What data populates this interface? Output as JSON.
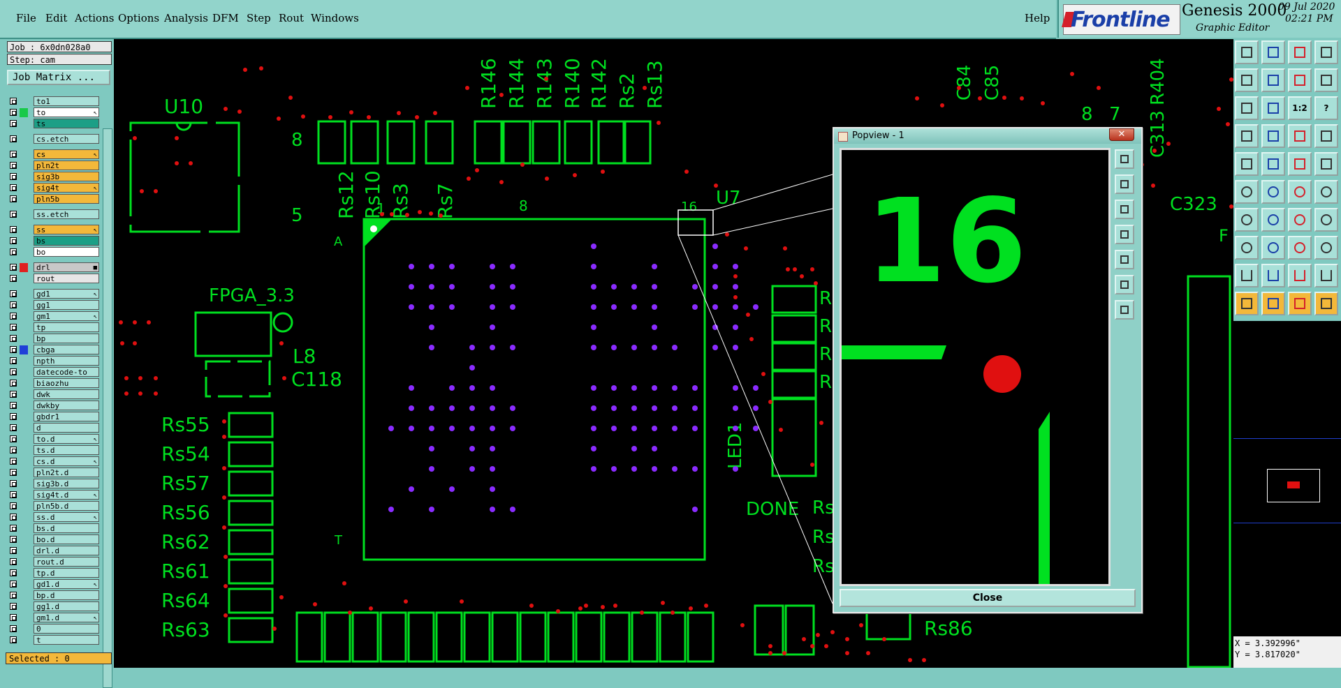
{
  "menu": [
    "File",
    "Edit",
    "Actions",
    "Options",
    "Analysis",
    "DFM",
    "Step",
    "Rout",
    "Windows"
  ],
  "help": "Help",
  "brand": {
    "logo": "Frontline",
    "product": "Genesis 2000",
    "subtitle": "Graphic Editor",
    "date": "09 Jul 2020",
    "time": "02:21 PM"
  },
  "job": {
    "job_label": "Job : 6x0dn028a0",
    "step_label": "Step: cam",
    "matrix_button": "Job Matrix ..."
  },
  "layers": [
    {
      "name": "to1",
      "color": "#a9e0d8"
    },
    {
      "name": "to",
      "color": "#ffffff",
      "swatch": "#18c94a",
      "flag": "↖"
    },
    {
      "name": "ts",
      "color": "#1c9f86"
    },
    {
      "name": "cs.etch",
      "color": "#a9e0d8"
    },
    {
      "name": "cs",
      "color": "#f3b83a",
      "flag": "↖"
    },
    {
      "name": "pln2t",
      "color": "#f3b83a"
    },
    {
      "name": "sig3b",
      "color": "#f3b83a"
    },
    {
      "name": "sig4t",
      "color": "#f3b83a",
      "flag": "↖"
    },
    {
      "name": "pln5b",
      "color": "#f3b83a"
    },
    {
      "name": "ss.etch",
      "color": "#a9e0d8"
    },
    {
      "name": "ss",
      "color": "#f3b83a",
      "flag": "↖"
    },
    {
      "name": "bs",
      "color": "#1c9f86"
    },
    {
      "name": "bo",
      "color": "#ffffff"
    },
    {
      "name": "drl",
      "color": "#c8c8c8",
      "swatch": "#e02020",
      "flag": "■"
    },
    {
      "name": "rout",
      "color": "#e6e6e6"
    },
    {
      "name": "gd1",
      "color": "#a9e0d8",
      "flag": "↖"
    },
    {
      "name": "gg1",
      "color": "#a9e0d8"
    },
    {
      "name": "gm1",
      "color": "#a9e0d8",
      "flag": "↖"
    },
    {
      "name": "tp",
      "color": "#a9e0d8"
    },
    {
      "name": "bp",
      "color": "#a9e0d8"
    },
    {
      "name": "cbga",
      "color": "#a9e0d8",
      "swatch": "#1f3fd8"
    },
    {
      "name": "npth",
      "color": "#a9e0d8"
    },
    {
      "name": "datecode-to",
      "color": "#a9e0d8"
    },
    {
      "name": "biaozhu",
      "color": "#a9e0d8"
    },
    {
      "name": "dwk",
      "color": "#a9e0d8"
    },
    {
      "name": "dwkby",
      "color": "#a9e0d8"
    },
    {
      "name": "gbdr1",
      "color": "#a9e0d8"
    },
    {
      "name": "d",
      "color": "#a9e0d8"
    },
    {
      "name": "to.d",
      "color": "#a9e0d8",
      "flag": "↖"
    },
    {
      "name": "ts.d",
      "color": "#a9e0d8"
    },
    {
      "name": "cs.d",
      "color": "#a9e0d8",
      "flag": "↖"
    },
    {
      "name": "pln2t.d",
      "color": "#a9e0d8"
    },
    {
      "name": "sig3b.d",
      "color": "#a9e0d8"
    },
    {
      "name": "sig4t.d",
      "color": "#a9e0d8",
      "flag": "↖"
    },
    {
      "name": "pln5b.d",
      "color": "#a9e0d8"
    },
    {
      "name": "ss.d",
      "color": "#a9e0d8",
      "flag": "↖"
    },
    {
      "name": "bs.d",
      "color": "#a9e0d8"
    },
    {
      "name": "bo.d",
      "color": "#a9e0d8"
    },
    {
      "name": "drl.d",
      "color": "#a9e0d8"
    },
    {
      "name": "rout.d",
      "color": "#a9e0d8"
    },
    {
      "name": "tp.d",
      "color": "#a9e0d8"
    },
    {
      "name": "gd1.d",
      "color": "#a9e0d8",
      "flag": "↖"
    },
    {
      "name": "bp.d",
      "color": "#a9e0d8"
    },
    {
      "name": "gg1.d",
      "color": "#a9e0d8"
    },
    {
      "name": "gm1.d",
      "color": "#a9e0d8",
      "flag": "↖"
    },
    {
      "name": "0",
      "color": "#a9e0d8"
    },
    {
      "name": "t",
      "color": "#a9e0d8"
    }
  ],
  "selected": "Selected : 0",
  "pcb": {
    "labels": {
      "u10": "U10",
      "u7": "U7",
      "fpga": "FPGA_3.3",
      "l8": "L8",
      "c118": "C118",
      "led1": "LED1",
      "done": "DONE",
      "c84": "C84",
      "c85": "C85",
      "c313": "C313",
      "r404": "R404",
      "c323": "C323",
      "rs86": "Rs86",
      "num8a": "8",
      "num5": "5",
      "pin1": "1",
      "pin8": "8",
      "pin16": "16",
      "markA": "A",
      "markT": "T",
      "num8b": "8",
      "num7": "7",
      "markF": "F",
      "markR": "R"
    },
    "top_resistors": [
      "R146",
      "R144",
      "R143",
      "R140",
      "R142",
      "Rs2",
      "Rs13"
    ],
    "left_resistors": [
      "Rs12",
      "Rs10",
      "Rs3",
      "Rs7"
    ],
    "side_resistors": [
      "Rs55",
      "Rs54",
      "Rs57",
      "Rs56",
      "Rs62",
      "Rs61",
      "Rs64",
      "Rs63"
    ],
    "right_partial": [
      "Rs",
      "Rs",
      "Rs"
    ]
  },
  "popview": {
    "title": "Popview - 1",
    "close_x": "✕",
    "zoom_text": "16",
    "close_button": "Close"
  },
  "coords": {
    "x": "X = 3.392996\"",
    "y": "Y = 3.817020\""
  },
  "toolbar": {
    "ratio_label": "1:2",
    "help_label": "?"
  },
  "colors": {
    "board_green": "#00e020",
    "drill_red": "#e01010",
    "via_purple": "#8a2cff"
  }
}
